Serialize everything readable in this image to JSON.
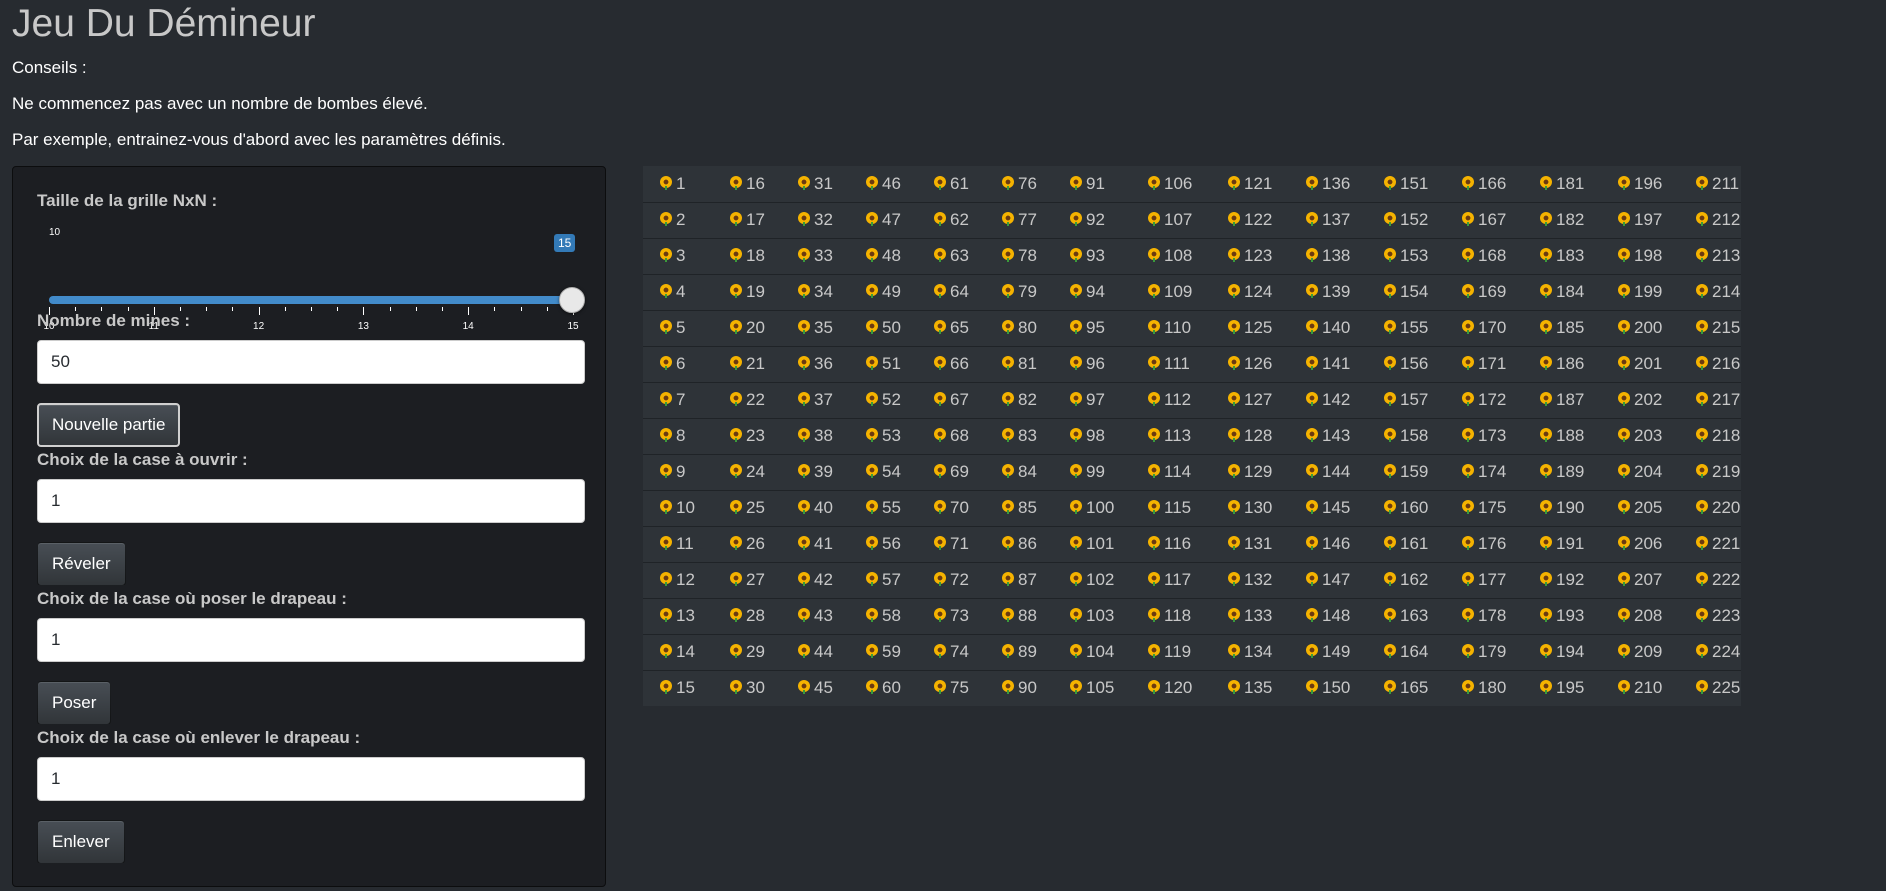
{
  "title": "Jeu Du Démineur",
  "tips": [
    "Conseils :",
    "Ne commencez pas avec un nombre de bombes élevé.",
    "Par exemple, entrainez-vous d'abord avec les paramètres définis."
  ],
  "sidebar": {
    "grid_size": {
      "label": "Taille de la grille NxN :",
      "min_label": "10",
      "value": "15",
      "tick_labels": [
        "10",
        "11",
        "12",
        "13",
        "14",
        "15"
      ]
    },
    "mines": {
      "label": "Nombre de mines :",
      "value": "50"
    },
    "new_game_label": "Nouvelle partie",
    "reveal": {
      "label": "Choix de la case à ouvrir :",
      "value": "1",
      "button": "Réveler"
    },
    "place_flag": {
      "label": "Choix de la case où poser le drapeau :",
      "value": "1",
      "button": "Poser"
    },
    "remove_flag": {
      "label": "Choix de la case où enlever le drapeau :",
      "value": "1",
      "button": "Enlever"
    }
  },
  "board": {
    "size": 15,
    "cell_icon": "sunflower-icon"
  },
  "colors": {
    "background": "#272b30",
    "panel": "#1c1e22",
    "slider": "#428bca",
    "board": "#2e3338"
  }
}
